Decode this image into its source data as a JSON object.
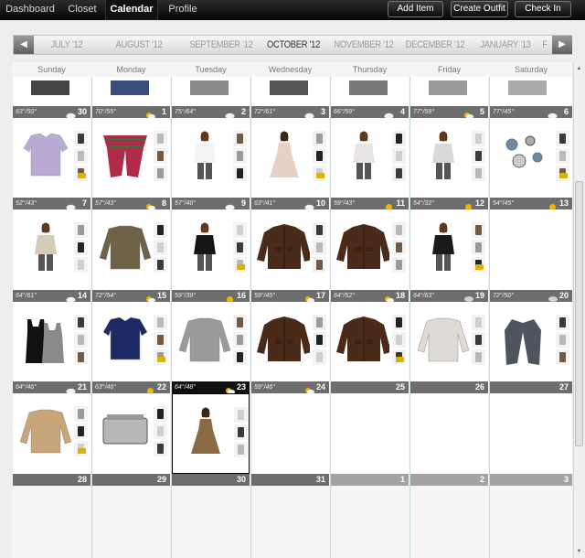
{
  "nav": {
    "tabs": [
      {
        "label": "Dashboard",
        "active": false
      },
      {
        "label": "Closet",
        "active": false
      },
      {
        "label": "Calendar",
        "active": true
      },
      {
        "label": "Profile",
        "active": false
      }
    ],
    "actions": [
      {
        "label": "Add Item"
      },
      {
        "label": "Create Outfit"
      },
      {
        "label": "Check In"
      }
    ]
  },
  "months": {
    "prev_icon": "chevron-left-icon",
    "next_icon": "chevron-right-icon",
    "items": [
      {
        "label": "JULY '12",
        "current": false
      },
      {
        "label": "AUGUST '12",
        "current": false
      },
      {
        "label": "SEPTEMBER '12",
        "current": false
      },
      {
        "label": "OCTOBER '12",
        "current": true
      },
      {
        "label": "NOVEMBER '12",
        "current": false
      },
      {
        "label": "DECEMBER '12",
        "current": false
      },
      {
        "label": "JANUARY '13",
        "current": false
      },
      {
        "label": "F",
        "current": false
      }
    ]
  },
  "weekdays": [
    "Sunday",
    "Monday",
    "Tuesday",
    "Wednesday",
    "Thursday",
    "Friday",
    "Saturday"
  ],
  "colors": {
    "header": "#6d6d6d",
    "header_faded": "#a3a3a3",
    "today": "#111111",
    "tag": "#d8b400",
    "gridline": "#c9d7dd"
  },
  "weeks": [
    {
      "days": [
        {
          "day": "30",
          "weather": "63°/50°",
          "icon": "cloud-icon",
          "outfit": "lavender-shirt"
        },
        {
          "day": "1",
          "weather": "70°/55°",
          "icon": "partly-sunny-icon",
          "outfit": "plaid-scarf"
        },
        {
          "day": "2",
          "weather": "75°/64°",
          "icon": "cloud-icon",
          "outfit": "white-tank"
        },
        {
          "day": "3",
          "weather": "72°/61°",
          "icon": "cloud-icon",
          "outfit": "lace-dress"
        },
        {
          "day": "4",
          "weather": "66°/59°",
          "icon": "cloud-icon",
          "outfit": "grey-tee"
        },
        {
          "day": "5",
          "weather": "77°/59°",
          "icon": "partly-sunny-icon",
          "outfit": "striped-tank"
        },
        {
          "day": "6",
          "weather": "77°/45°",
          "icon": "cloud-icon",
          "outfit": "earrings"
        }
      ]
    },
    {
      "days": [
        {
          "day": "7",
          "weather": "52°/43°",
          "icon": "cloud-icon",
          "outfit": "silk-blouse"
        },
        {
          "day": "8",
          "weather": "57°/43°",
          "icon": "partly-sunny-icon",
          "outfit": "olive-sweater"
        },
        {
          "day": "9",
          "weather": "57°/46°",
          "icon": "cloud-icon",
          "outfit": "black-cami"
        },
        {
          "day": "10",
          "weather": "63°/41°",
          "icon": "cloud-icon",
          "outfit": "brown-jacket"
        },
        {
          "day": "11",
          "weather": "59°/43°",
          "icon": "sun-icon",
          "outfit": "brown-jacket"
        },
        {
          "day": "12",
          "weather": "54°/32°",
          "icon": "sun-icon",
          "outfit": "black-top"
        },
        {
          "day": "13",
          "weather": "54°/45°",
          "icon": "sun-icon",
          "outfit": ""
        }
      ]
    },
    {
      "days": [
        {
          "day": "14",
          "weather": "64°/61°",
          "icon": "cloud-icon",
          "outfit": "black-grey-tanks"
        },
        {
          "day": "15",
          "weather": "72°/54°",
          "icon": "partly-sunny-icon",
          "outfit": "navy-tee"
        },
        {
          "day": "16",
          "weather": "59°/39°",
          "icon": "sun-icon",
          "outfit": "grey-sweater"
        },
        {
          "day": "17",
          "weather": "59°/45°",
          "icon": "partly-sunny-icon",
          "outfit": "brown-jacket"
        },
        {
          "day": "18",
          "weather": "64°/52°",
          "icon": "partly-sunny-icon",
          "outfit": "brown-jacket"
        },
        {
          "day": "19",
          "weather": "64°/63°",
          "icon": "rain-icon",
          "outfit": "white-sweater"
        },
        {
          "day": "20",
          "weather": "72°/50°",
          "icon": "rain-icon",
          "outfit": "grey-cardigan"
        }
      ]
    },
    {
      "days": [
        {
          "day": "21",
          "weather": "64°/46°",
          "icon": "cloud-icon",
          "outfit": "tan-sweater"
        },
        {
          "day": "22",
          "weather": "63°/46°",
          "icon": "sun-icon",
          "outfit": "silver-clutch"
        },
        {
          "day": "23",
          "weather": "64°/48°",
          "icon": "partly-sunny-icon",
          "outfit": "tan-dress",
          "today": true
        },
        {
          "day": "24",
          "weather": "59°/46°",
          "icon": "partly-sunny-icon",
          "outfit": ""
        },
        {
          "day": "25",
          "weather": "",
          "icon": "",
          "outfit": ""
        },
        {
          "day": "26",
          "weather": "",
          "icon": "",
          "outfit": ""
        },
        {
          "day": "27",
          "weather": "",
          "icon": "",
          "outfit": ""
        }
      ]
    },
    {
      "days": [
        {
          "day": "28",
          "weather": "",
          "icon": "",
          "outfit": ""
        },
        {
          "day": "29",
          "weather": "",
          "icon": "",
          "outfit": ""
        },
        {
          "day": "30",
          "weather": "",
          "icon": "",
          "outfit": ""
        },
        {
          "day": "31",
          "weather": "",
          "icon": "",
          "outfit": ""
        },
        {
          "day": "1",
          "weather": "",
          "icon": "",
          "outfit": "",
          "faded": true
        },
        {
          "day": "2",
          "weather": "",
          "icon": "",
          "outfit": "",
          "faded": true
        },
        {
          "day": "3",
          "weather": "",
          "icon": "",
          "outfit": "",
          "faded": true
        }
      ]
    }
  ]
}
